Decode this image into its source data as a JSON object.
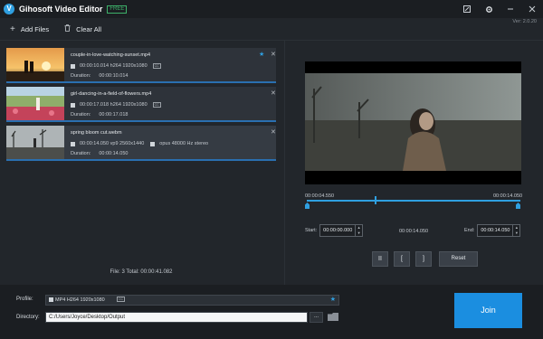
{
  "app": {
    "logo_letter": "V",
    "title": "Gihosoft Video Editor",
    "badge": "FREE",
    "version": "Ver: 2.0.20"
  },
  "toolbar": {
    "add_files": "Add Files",
    "clear_all": "Clear All"
  },
  "files": [
    {
      "name": "couple-in-love-watching-sunset.mp4",
      "video": "00:00:10.014 h264 1920x1080",
      "audio": "",
      "duration_label": "Duration:",
      "duration": "00:00:10.014",
      "starred": true
    },
    {
      "name": "girl-dancing-in-a-field-of-flowers.mp4",
      "video": "00:00:17.018 h264 1920x1080",
      "audio": "",
      "duration_label": "Duration:",
      "duration": "00:00:17.018",
      "starred": false
    },
    {
      "name": "spring bloom cut.webm",
      "video": "00:00:14.050 vp9 2560x1440",
      "audio": "opus 48000 Hz stereo",
      "duration_label": "Duration:",
      "duration": "00:00:14.050",
      "starred": false
    }
  ],
  "summary": "File: 3   Total: 00:00:41.082",
  "player": {
    "time_start": "00:00:04.550",
    "time_end": "00:00:14.050",
    "start_label": "Start:",
    "start_value": "00:00:00.000",
    "mid_value": "00:00:14.050",
    "end_label": "End:",
    "end_value": "00:00:14.050",
    "playhead_fraction": 0.32,
    "btn_pause": "II",
    "btn_mark_in": "[",
    "btn_mark_out": "]",
    "reset": "Reset"
  },
  "output": {
    "profile_label": "Profile:",
    "profile_value": "MP4 H264 1920x1080",
    "directory_label": "Directory:",
    "directory_value": "C:/Users/Joyce/Desktop/Output",
    "browse": "...",
    "join": "Join"
  },
  "colors": {
    "accent": "#2f9fe0",
    "join": "#1b8ee0",
    "badge": "#3db26a"
  }
}
